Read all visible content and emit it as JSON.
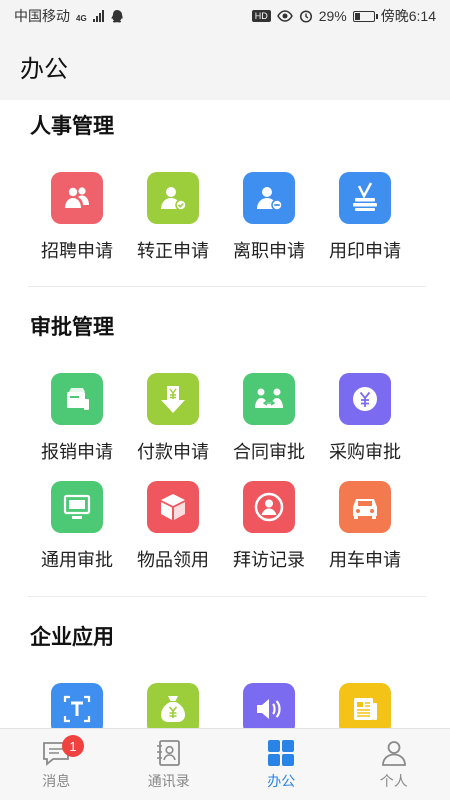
{
  "status": {
    "carrier": "中国移动",
    "network": "4G",
    "hd": "HD",
    "battery_percent": "29%",
    "battery_level": 0.29,
    "time": "傍晚6:14"
  },
  "header": {
    "title": "办公"
  },
  "sections": [
    {
      "title": "人事管理",
      "items": [
        {
          "label": "招聘申请",
          "color": "#f0626b",
          "icon": "recruit-icon"
        },
        {
          "label": "转正申请",
          "color": "#9ccd3a",
          "icon": "regularize-icon"
        },
        {
          "label": "离职申请",
          "color": "#3f8ff0",
          "icon": "resign-icon"
        },
        {
          "label": "用印申请",
          "color": "#3f8ff0",
          "icon": "seal-icon"
        }
      ]
    },
    {
      "title": "审批管理",
      "items": [
        {
          "label": "报销申请",
          "color": "#4dc874",
          "icon": "reimburse-icon"
        },
        {
          "label": "付款申请",
          "color": "#9ccd3a",
          "icon": "payment-icon"
        },
        {
          "label": "合同审批",
          "color": "#4dc874",
          "icon": "contract-icon"
        },
        {
          "label": "采购审批",
          "color": "#7b6bf0",
          "icon": "purchase-icon"
        },
        {
          "label": "通用审批",
          "color": "#4dc874",
          "icon": "general-approval-icon"
        },
        {
          "label": "物品领用",
          "color": "#f0565e",
          "icon": "goods-icon"
        },
        {
          "label": "拜访记录",
          "color": "#f0565e",
          "icon": "visit-icon"
        },
        {
          "label": "用车申请",
          "color": "#f5794f",
          "icon": "car-icon"
        }
      ]
    },
    {
      "title": "企业应用",
      "items": [
        {
          "label": "",
          "color": "#3f8ff0",
          "icon": "text-icon"
        },
        {
          "label": "",
          "color": "#9ccd3a",
          "icon": "money-bag-icon"
        },
        {
          "label": "",
          "color": "#7b6bf0",
          "icon": "speaker-icon"
        },
        {
          "label": "",
          "color": "#f4c317",
          "icon": "news-icon"
        }
      ]
    }
  ],
  "tabs": [
    {
      "label": "消息",
      "icon": "message-icon",
      "badge": "1"
    },
    {
      "label": "通讯录",
      "icon": "contacts-icon"
    },
    {
      "label": "办公",
      "icon": "office-grid-icon",
      "active": true
    },
    {
      "label": "个人",
      "icon": "person-icon"
    }
  ]
}
